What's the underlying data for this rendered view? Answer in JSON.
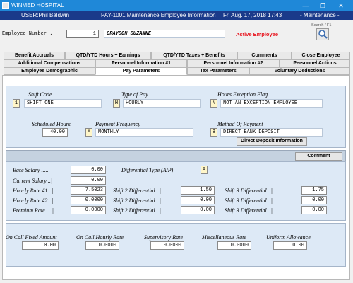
{
  "window": {
    "title": "WINMED HOSPITAL",
    "minimize_glyph": "—",
    "maximize_glyph": "❐",
    "close_glyph": "✕"
  },
  "header": {
    "user": "USER:Phil Baldwin",
    "screen": "PAY-1001  Maintenance Employee Information",
    "datetime": "Fri Aug. 17, 2018 17:43",
    "mode": "- Maintenance -"
  },
  "employee": {
    "label": "Employee Number .|",
    "number": "1",
    "name": "GRAYSON SUZANNE",
    "status": "Active Employee",
    "search_label": "Search / F1"
  },
  "tabs": {
    "row1": [
      "Benefit Accruals",
      "QTD/YTD Hours + Earnings",
      "QTD/YTD Taxes + Benefits",
      "Comments",
      "Close Employee"
    ],
    "row2": [
      "Additional Compensations",
      "Personnel Information #1",
      "Personnel Information #2",
      "Personnel Actions"
    ],
    "row3": [
      "Employee Demographic",
      "Pay Parameters",
      "Tax Parameters",
      "Voluntary Deductions"
    ],
    "active": "Pay Parameters"
  },
  "pay": {
    "shift_code_label": "Shift Code",
    "shift_code": "1",
    "shift_desc": "SHIFT ONE",
    "type_pay_label": "Type of Pay",
    "type_pay_code": "H",
    "type_pay_desc": "HOURLY",
    "hours_exc_label": "Hours Exception Flag",
    "hours_exc_code": "N",
    "hours_exc_desc": "NOT AN EXCEPTION EMPLOYEE",
    "sched_hours_label": "Scheduled Hours",
    "sched_hours": "40.00",
    "pay_freq_label": "Payment Frequency",
    "pay_freq_code": "M",
    "pay_freq_desc": "MONTHLY",
    "method_label": "Method Of Payment",
    "method_code": "B",
    "method_desc": "DIRECT BANK DEPOSIT",
    "direct_deposit_button": "Direct Deposit Information"
  },
  "rates": {
    "comment_button": "Comment",
    "base_salary_label": "Base Salary .....|",
    "base_salary": "0.00",
    "current_salary_label": "Current Salary ..|",
    "current_salary": "0.00",
    "diff_type_label": "Differential Type (A/P)",
    "diff_type": "A",
    "hourly1_label": "Hourly Rate #1 ..|",
    "hourly1": "7.5023",
    "hourly2_label": "Hourly Rate #2 ..|",
    "hourly2": "0.0000",
    "premium_label": "Premium Rate ....|",
    "premium": "0.0000",
    "s2_label": "Shift 2 Differential ..|",
    "s3_label": "Shift 3 Differential ..|",
    "s2_values": [
      "1.50",
      "0.00",
      "0.00"
    ],
    "s3_values": [
      "1.75",
      "0.00",
      "0.00"
    ]
  },
  "oncall": {
    "labels": [
      "On Call Fixed Amount",
      "On Call Hourly Rate",
      "Supervisory Rate",
      "Miscellaneous Rate",
      "Uniform Allowance"
    ],
    "values": [
      "0.00",
      "0.0000",
      "0.0000",
      "0.0000",
      "0.00"
    ]
  }
}
